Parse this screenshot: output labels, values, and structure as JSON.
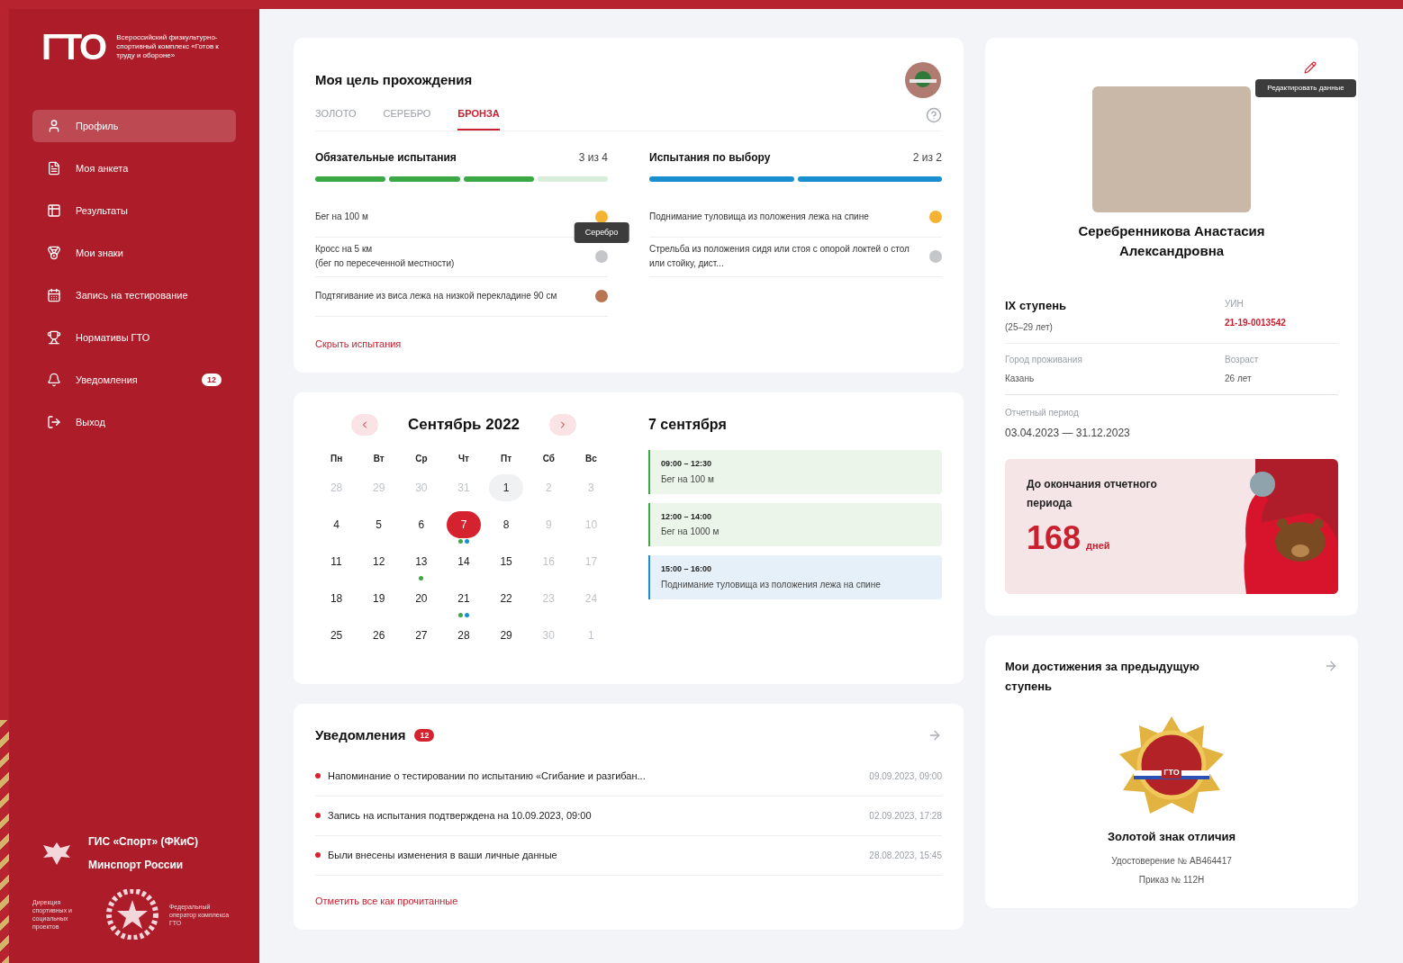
{
  "sidebar": {
    "logo": {
      "mark": "ГТО",
      "caption": "Всероссийский физкультурно-спортивный комплекс «Готов к труду и обороне»"
    },
    "items": [
      {
        "label": "Профиль",
        "selected": true
      },
      {
        "label": "Моя анкета",
        "selected": false
      },
      {
        "label": "Результаты",
        "selected": false
      },
      {
        "label": "Мои знаки",
        "selected": false
      },
      {
        "label": "Запись на тестирование",
        "selected": false
      },
      {
        "label": "Нормативы ГТО",
        "selected": false
      },
      {
        "label": "Уведомления",
        "selected": false,
        "badge": "12"
      },
      {
        "label": "Выход",
        "selected": false
      }
    ],
    "footer": {
      "lines": [
        "ГИС «Спорт» (ФКиС)",
        "Минспорт России"
      ],
      "left_caption": "Дирекция спортивных и социальных проектов",
      "right_caption": "Федеральный оператор комплекса ГТО"
    }
  },
  "goal": {
    "title": "Моя цель прохождения",
    "tabs": [
      {
        "label": "ЗОЛОТО",
        "selected": false
      },
      {
        "label": "СЕРЕБРО",
        "selected": false
      },
      {
        "label": "БРОНЗА",
        "selected": true
      }
    ],
    "groups": [
      {
        "title": "Обязательные испытания",
        "count": "3 из 4",
        "color": "#3aa845",
        "segments": [
          {
            "done": true
          },
          {
            "done": true
          },
          {
            "done": true
          },
          {
            "done": false
          }
        ],
        "tests": [
          {
            "name": "Бег на 100 м",
            "color": "#f5b233"
          },
          {
            "name": "Кросс на 5 км\n(бег по пересеченной местности)",
            "color": "#c4c6c9",
            "tooltip": "Серебро"
          },
          {
            "name": "Подтягивание из виса лежа на низкой перекладине 90 см",
            "color": "#b87552"
          }
        ]
      },
      {
        "title": "Испытания по выбору",
        "count": "2 из 2",
        "color": "#1a8fd0",
        "segments": [
          {
            "done": true
          },
          {
            "done": true
          }
        ],
        "tests": [
          {
            "name": "Поднимание туловища из положения лежа на спине",
            "color": "#f5b233"
          },
          {
            "name": "Стрельба из положения сидя или стоя с опорой локтей о стол или стойку, дист...",
            "color": "#c4c6c9"
          }
        ]
      }
    ],
    "link": "Скрыть испытания"
  },
  "calendar": {
    "month": "Сентябрь 2022",
    "weekdays": [
      "Пн",
      "Вт",
      "Ср",
      "Чт",
      "Пт",
      "Сб",
      "Вс"
    ],
    "weeks": [
      [
        {
          "day": "28",
          "muted": true,
          "today": false,
          "selected": false
        },
        {
          "day": "29",
          "muted": true,
          "today": false,
          "selected": false
        },
        {
          "day": "30",
          "muted": true,
          "today": false,
          "selected": false
        },
        {
          "day": "31",
          "muted": true,
          "today": false,
          "selected": false
        },
        {
          "day": "1",
          "muted": false,
          "today": true,
          "selected": false
        },
        {
          "day": "2",
          "muted": true,
          "today": false,
          "selected": false
        },
        {
          "day": "3",
          "muted": true,
          "today": false,
          "selected": false
        }
      ],
      [
        {
          "day": "4",
          "muted": false,
          "today": false,
          "selected": false
        },
        {
          "day": "5",
          "muted": false,
          "today": false,
          "selected": false
        },
        {
          "day": "6",
          "muted": false,
          "today": false,
          "selected": false
        },
        {
          "day": "7",
          "muted": false,
          "today": false,
          "selected": true,
          "dots": [
            {
              "color": "#3aa845"
            },
            {
              "color": "#1a8fd0"
            }
          ]
        },
        {
          "day": "8",
          "muted": false,
          "today": false,
          "selected": false
        },
        {
          "day": "9",
          "muted": true,
          "today": false,
          "selected": false
        },
        {
          "day": "10",
          "muted": true,
          "today": false,
          "selected": false
        }
      ],
      [
        {
          "day": "11",
          "muted": false,
          "today": false,
          "selected": false
        },
        {
          "day": "12",
          "muted": false,
          "today": false,
          "selected": false
        },
        {
          "day": "13",
          "muted": false,
          "today": false,
          "selected": false,
          "dots": [
            {
              "color": "#3aa845"
            }
          ]
        },
        {
          "day": "14",
          "muted": false,
          "today": false,
          "selected": false
        },
        {
          "day": "15",
          "muted": false,
          "today": false,
          "selected": false
        },
        {
          "day": "16",
          "muted": true,
          "today": false,
          "selected": false
        },
        {
          "day": "17",
          "muted": true,
          "today": false,
          "selected": false
        }
      ],
      [
        {
          "day": "18",
          "muted": false,
          "today": false,
          "selected": false
        },
        {
          "day": "19",
          "muted": false,
          "today": false,
          "selected": false
        },
        {
          "day": "20",
          "muted": false,
          "today": false,
          "selected": false
        },
        {
          "day": "21",
          "muted": false,
          "today": false,
          "selected": false,
          "dots": [
            {
              "color": "#3aa845"
            },
            {
              "color": "#1a8fd0"
            }
          ]
        },
        {
          "day": "22",
          "muted": false,
          "today": false,
          "selected": false
        },
        {
          "day": "23",
          "muted": true,
          "today": false,
          "selected": false
        },
        {
          "day": "24",
          "muted": true,
          "today": false,
          "selected": false
        }
      ],
      [
        {
          "day": "25",
          "muted": false,
          "today": false,
          "selected": false
        },
        {
          "day": "26",
          "muted": false,
          "today": false,
          "selected": false
        },
        {
          "day": "27",
          "muted": false,
          "today": false,
          "selected": false
        },
        {
          "day": "28",
          "muted": false,
          "today": false,
          "selected": false
        },
        {
          "day": "29",
          "muted": false,
          "today": false,
          "selected": false
        },
        {
          "day": "30",
          "muted": true,
          "today": false,
          "selected": false
        },
        {
          "day": "1",
          "muted": true,
          "today": false,
          "selected": false
        }
      ]
    ],
    "date": "7 сентября",
    "events": [
      {
        "time": "09:00 – 12:30",
        "title": "Бег на 100 м",
        "color": "#3aa845"
      },
      {
        "time": "12:00 – 14:00",
        "title": "Бег на 1000 м",
        "color": "#3aa845"
      },
      {
        "time": "15:00 – 16:00",
        "title": "Поднимание туловища из положения лежа на спине",
        "color": "#1a8fd0"
      }
    ]
  },
  "notifications": {
    "title": "Уведомления",
    "badge": "12",
    "items": [
      {
        "text": "Напоминание о тестировании по испытанию «Сгибание и разгибан...",
        "time": "09.09.2023, 09:00",
        "unread": true
      },
      {
        "text": "Запись на испытания подтверждена на 10.09.2023, 09:00",
        "time": "02.09.2023, 17:28",
        "unread": true
      },
      {
        "text": "Были внесены изменения в ваши личные данные",
        "time": "28.08.2023, 15:45",
        "unread": true
      }
    ],
    "link": "Отметить все как прочитанные"
  },
  "profile": {
    "edit_tooltip": "Редактировать данные",
    "name": "Серебренникова Анастасия Александровна",
    "fields": [
      {
        "label": "IX ступень",
        "value": "(25–29 лет)",
        "kind": "stage"
      },
      {
        "label": "УИН",
        "value": "21-19-0013542",
        "kind": "code"
      },
      {
        "label": "Город проживания",
        "value": "Казань",
        "kind": "plain"
      },
      {
        "label": "Возраст",
        "value": "26 лет",
        "kind": "plain"
      }
    ],
    "period": {
      "label": "Отчетный период",
      "value": "03.04.2023 — 31.12.2023"
    },
    "countdown": {
      "title": "До окончания отчетного периода",
      "number": "168",
      "unit": "дней"
    }
  },
  "achievements": {
    "title": "Мои достижения за предыдущую ступень",
    "badge_label": "ГТО",
    "award": "Золотой знак отличия",
    "certificate": "Удостоверение № АВ464417",
    "order": "Приказ № 112Н"
  }
}
